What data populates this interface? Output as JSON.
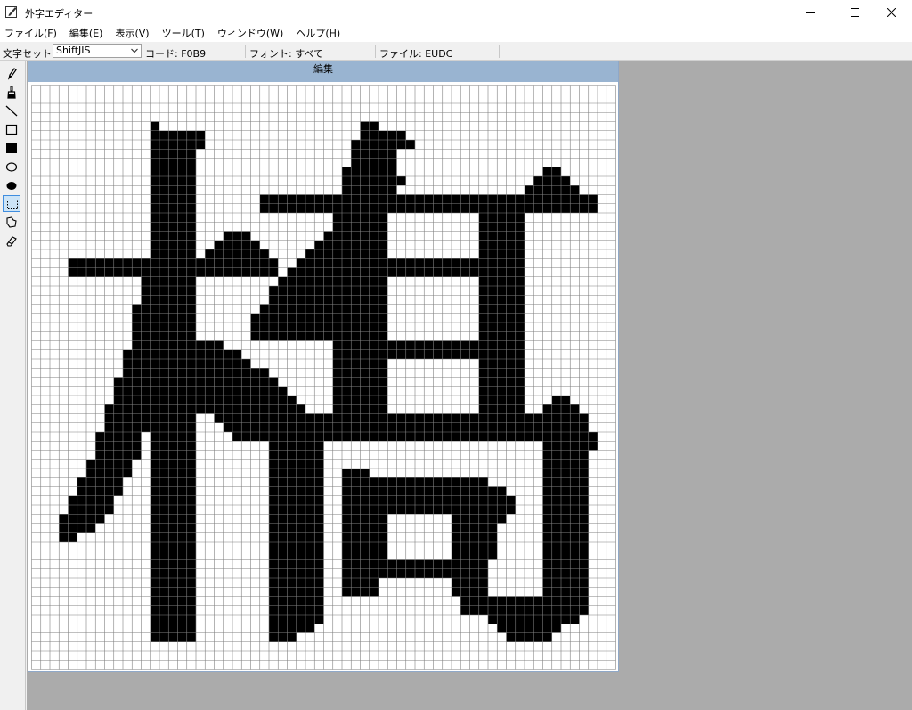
{
  "window": {
    "title": "外字エディター",
    "controls": {
      "minimize": "─",
      "maximize": "☐",
      "close": "✕"
    }
  },
  "menu": [
    {
      "label": "ファイル(F)"
    },
    {
      "label": "編集(E)"
    },
    {
      "label": "表示(V)"
    },
    {
      "label": "ツール(T)"
    },
    {
      "label": "ウィンドウ(W)"
    },
    {
      "label": "ヘルプ(H)"
    }
  ],
  "toolbar": {
    "charset_label": "文字セット:",
    "charset_value": "ShiftJIS",
    "code": "コード: F0B9",
    "font": "フォント: すべて",
    "file": "ファイル: EUDC"
  },
  "tools": [
    {
      "name": "pencil-tool",
      "icon": "pencil-icon"
    },
    {
      "name": "brush-tool",
      "icon": "brush-icon"
    },
    {
      "name": "line-tool",
      "icon": "line-icon"
    },
    {
      "name": "hollow-rectangle-tool",
      "icon": "rectangle-outline-icon"
    },
    {
      "name": "filled-rectangle-tool",
      "icon": "rectangle-filled-icon"
    },
    {
      "name": "hollow-ellipse-tool",
      "icon": "ellipse-outline-icon"
    },
    {
      "name": "filled-ellipse-tool",
      "icon": "ellipse-filled-icon"
    },
    {
      "name": "rectangular-selection-tool",
      "icon": "selection-rectangle-icon",
      "active": true
    },
    {
      "name": "freeform-selection-tool",
      "icon": "selection-freeform-icon"
    },
    {
      "name": "eraser-tool",
      "icon": "eraser-icon"
    }
  ],
  "editor": {
    "caption": "編集",
    "grid_size": 64,
    "filled_color": "#000000",
    "empty_color": "#ffffff",
    "line_color": "#808080",
    "filled_runs": [
      [
        4,
        13,
        13
      ],
      [
        4,
        36,
        37
      ],
      [
        5,
        13,
        18
      ],
      [
        5,
        36,
        40
      ],
      [
        6,
        13,
        18
      ],
      [
        6,
        35,
        41
      ],
      [
        7,
        13,
        17
      ],
      [
        7,
        35,
        39
      ],
      [
        8,
        13,
        17
      ],
      [
        8,
        35,
        39
      ],
      [
        9,
        13,
        17
      ],
      [
        9,
        34,
        39
      ],
      [
        9,
        56,
        57
      ],
      [
        10,
        13,
        17
      ],
      [
        10,
        34,
        40
      ],
      [
        10,
        55,
        58
      ],
      [
        11,
        13,
        17
      ],
      [
        11,
        34,
        39
      ],
      [
        11,
        54,
        59
      ],
      [
        12,
        13,
        17
      ],
      [
        12,
        25,
        61
      ],
      [
        13,
        13,
        17
      ],
      [
        13,
        25,
        61
      ],
      [
        14,
        13,
        17
      ],
      [
        14,
        33,
        38
      ],
      [
        14,
        49,
        53
      ],
      [
        15,
        13,
        17
      ],
      [
        15,
        33,
        38
      ],
      [
        15,
        49,
        53
      ],
      [
        16,
        13,
        17
      ],
      [
        16,
        21,
        23
      ],
      [
        16,
        32,
        38
      ],
      [
        16,
        49,
        53
      ],
      [
        17,
        13,
        17
      ],
      [
        17,
        20,
        24
      ],
      [
        17,
        31,
        38
      ],
      [
        17,
        49,
        53
      ],
      [
        18,
        13,
        17
      ],
      [
        18,
        19,
        25
      ],
      [
        18,
        30,
        38
      ],
      [
        18,
        49,
        53
      ],
      [
        19,
        4,
        26
      ],
      [
        19,
        29,
        53
      ],
      [
        20,
        4,
        26
      ],
      [
        20,
        28,
        53
      ],
      [
        21,
        12,
        17
      ],
      [
        21,
        27,
        38
      ],
      [
        21,
        49,
        53
      ],
      [
        22,
        12,
        17
      ],
      [
        22,
        26,
        38
      ],
      [
        22,
        49,
        53
      ],
      [
        23,
        12,
        17
      ],
      [
        23,
        26,
        38
      ],
      [
        23,
        49,
        53
      ],
      [
        24,
        11,
        17
      ],
      [
        24,
        25,
        38
      ],
      [
        24,
        49,
        53
      ],
      [
        25,
        11,
        17
      ],
      [
        25,
        24,
        38
      ],
      [
        25,
        49,
        53
      ],
      [
        26,
        11,
        17
      ],
      [
        26,
        24,
        38
      ],
      [
        26,
        49,
        53
      ],
      [
        27,
        11,
        17
      ],
      [
        27,
        24,
        38
      ],
      [
        27,
        49,
        53
      ],
      [
        28,
        11,
        20
      ],
      [
        28,
        33,
        53
      ],
      [
        29,
        10,
        22
      ],
      [
        29,
        33,
        53
      ],
      [
        30,
        10,
        23
      ],
      [
        30,
        33,
        38
      ],
      [
        30,
        49,
        53
      ],
      [
        31,
        10,
        25
      ],
      [
        31,
        33,
        38
      ],
      [
        31,
        49,
        53
      ],
      [
        32,
        9,
        26
      ],
      [
        32,
        33,
        38
      ],
      [
        32,
        49,
        53
      ],
      [
        33,
        9,
        27
      ],
      [
        33,
        33,
        38
      ],
      [
        33,
        49,
        53
      ],
      [
        34,
        9,
        28
      ],
      [
        34,
        33,
        38
      ],
      [
        34,
        49,
        53
      ],
      [
        34,
        57,
        58
      ],
      [
        35,
        8,
        29
      ],
      [
        35,
        33,
        38
      ],
      [
        35,
        49,
        53
      ],
      [
        35,
        56,
        59
      ],
      [
        36,
        8,
        12
      ],
      [
        36,
        13,
        17
      ],
      [
        36,
        20,
        60
      ],
      [
        37,
        8,
        12
      ],
      [
        37,
        13,
        17
      ],
      [
        37,
        21,
        60
      ],
      [
        38,
        7,
        11
      ],
      [
        38,
        13,
        17
      ],
      [
        38,
        22,
        61
      ],
      [
        39,
        7,
        11
      ],
      [
        39,
        13,
        17
      ],
      [
        39,
        26,
        31
      ],
      [
        39,
        56,
        61
      ],
      [
        40,
        7,
        11
      ],
      [
        40,
        13,
        17
      ],
      [
        40,
        26,
        31
      ],
      [
        40,
        56,
        60
      ],
      [
        41,
        6,
        10
      ],
      [
        41,
        13,
        17
      ],
      [
        41,
        26,
        31
      ],
      [
        41,
        56,
        60
      ],
      [
        42,
        6,
        10
      ],
      [
        42,
        13,
        17
      ],
      [
        42,
        26,
        31
      ],
      [
        42,
        34,
        36
      ],
      [
        42,
        56,
        60
      ],
      [
        43,
        5,
        9
      ],
      [
        43,
        13,
        17
      ],
      [
        43,
        26,
        31
      ],
      [
        43,
        34,
        49
      ],
      [
        43,
        56,
        60
      ],
      [
        44,
        5,
        9
      ],
      [
        44,
        13,
        17
      ],
      [
        44,
        26,
        31
      ],
      [
        44,
        34,
        51
      ],
      [
        44,
        56,
        60
      ],
      [
        45,
        4,
        8
      ],
      [
        45,
        13,
        17
      ],
      [
        45,
        26,
        31
      ],
      [
        45,
        34,
        52
      ],
      [
        45,
        56,
        60
      ],
      [
        46,
        4,
        8
      ],
      [
        46,
        13,
        17
      ],
      [
        46,
        26,
        31
      ],
      [
        46,
        34,
        52
      ],
      [
        46,
        56,
        60
      ],
      [
        47,
        3,
        7
      ],
      [
        47,
        13,
        17
      ],
      [
        47,
        26,
        31
      ],
      [
        47,
        34,
        38
      ],
      [
        47,
        46,
        51
      ],
      [
        47,
        56,
        60
      ],
      [
        48,
        3,
        6
      ],
      [
        48,
        13,
        17
      ],
      [
        48,
        26,
        31
      ],
      [
        48,
        34,
        38
      ],
      [
        48,
        46,
        50
      ],
      [
        48,
        56,
        60
      ],
      [
        49,
        3,
        4
      ],
      [
        49,
        13,
        17
      ],
      [
        49,
        26,
        31
      ],
      [
        49,
        34,
        38
      ],
      [
        49,
        46,
        50
      ],
      [
        49,
        56,
        60
      ],
      [
        50,
        13,
        17
      ],
      [
        50,
        26,
        31
      ],
      [
        50,
        34,
        38
      ],
      [
        50,
        46,
        50
      ],
      [
        50,
        56,
        60
      ],
      [
        51,
        13,
        17
      ],
      [
        51,
        26,
        31
      ],
      [
        51,
        34,
        38
      ],
      [
        51,
        46,
        50
      ],
      [
        51,
        56,
        60
      ],
      [
        52,
        13,
        17
      ],
      [
        52,
        26,
        31
      ],
      [
        52,
        34,
        49
      ],
      [
        52,
        56,
        60
      ],
      [
        53,
        13,
        17
      ],
      [
        53,
        26,
        31
      ],
      [
        53,
        34,
        49
      ],
      [
        53,
        56,
        60
      ],
      [
        54,
        13,
        17
      ],
      [
        54,
        26,
        31
      ],
      [
        54,
        34,
        37
      ],
      [
        54,
        46,
        49
      ],
      [
        54,
        56,
        60
      ],
      [
        55,
        13,
        17
      ],
      [
        55,
        26,
        31
      ],
      [
        55,
        34,
        37
      ],
      [
        55,
        46,
        49
      ],
      [
        55,
        56,
        60
      ],
      [
        56,
        13,
        17
      ],
      [
        56,
        26,
        31
      ],
      [
        56,
        47,
        60
      ],
      [
        57,
        13,
        17
      ],
      [
        57,
        26,
        31
      ],
      [
        57,
        47,
        60
      ],
      [
        58,
        13,
        17
      ],
      [
        58,
        26,
        31
      ],
      [
        58,
        50,
        59
      ],
      [
        59,
        13,
        17
      ],
      [
        59,
        26,
        30
      ],
      [
        59,
        51,
        57
      ],
      [
        60,
        13,
        17
      ],
      [
        60,
        26,
        28
      ],
      [
        60,
        52,
        56
      ]
    ]
  }
}
